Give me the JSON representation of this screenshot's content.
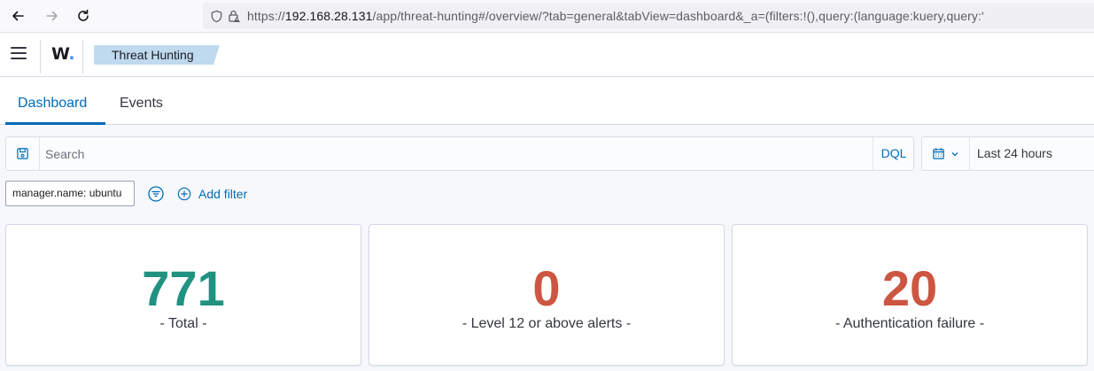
{
  "browser": {
    "url_prefix": "https://",
    "url_host": "192.168.28.131",
    "url_path": "/app/threat-hunting#/overview/?tab=general&tabView=dashboard&_a=(filters:!(),query:(language:kuery,query:'"
  },
  "header": {
    "logo_text": "W",
    "logo_dot": ".",
    "breadcrumb": "Threat Hunting"
  },
  "tabs": [
    {
      "label": "Dashboard",
      "active": true
    },
    {
      "label": "Events",
      "active": false
    }
  ],
  "search": {
    "placeholder": "Search",
    "language_label": "DQL"
  },
  "date_picker": {
    "label": "Last 24 hours"
  },
  "filters": {
    "pill": "manager.name: ubuntu",
    "add_label": "Add filter"
  },
  "stats": [
    {
      "value": "771",
      "label": "- Total -",
      "color": "#209280"
    },
    {
      "value": "0",
      "label": "- Level 12 or above alerts -",
      "color": "#cc5642"
    },
    {
      "value": "20",
      "label": "- Authentication failure -",
      "color": "#cc5642"
    }
  ],
  "colors": {
    "accent": "#006bb8",
    "breadcrumb_bg": "#bfd9ee"
  }
}
